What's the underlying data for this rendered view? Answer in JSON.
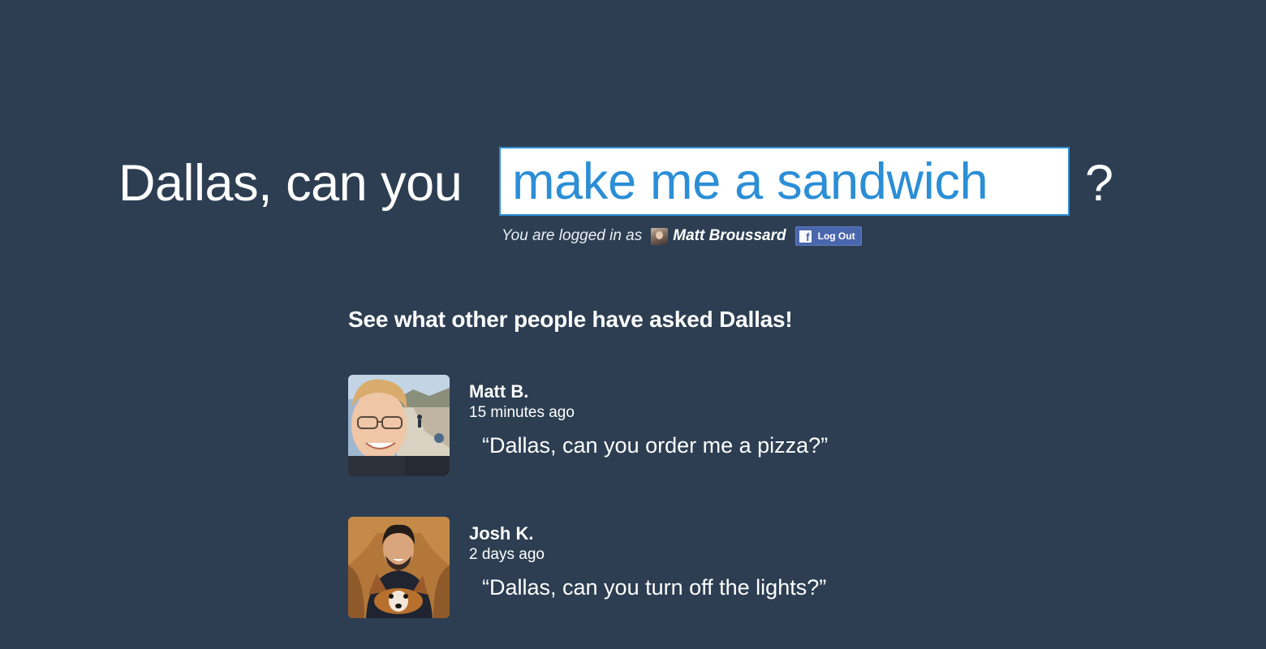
{
  "hero": {
    "prefix": "Dallas, can you",
    "input_value": "make me a sandwich",
    "suffix": "?"
  },
  "login": {
    "label": "You are logged in as",
    "user_name": "Matt Broussard",
    "logout_label": "Log Out",
    "facebook_icon_glyph": "f"
  },
  "feed": {
    "heading": "See what other people have asked Dallas!",
    "items": [
      {
        "name": "Matt B.",
        "time": "15 minutes ago",
        "question": "“Dallas, can you order me a pizza?”"
      },
      {
        "name": "Josh K.",
        "time": "2 days ago",
        "question": "“Dallas, can you turn off the lights?”"
      }
    ]
  },
  "colors": {
    "background": "#2d3e52",
    "input_text": "#2b8ed6",
    "input_border": "#2f8fd6",
    "facebook_blue": "#4a66ac"
  }
}
